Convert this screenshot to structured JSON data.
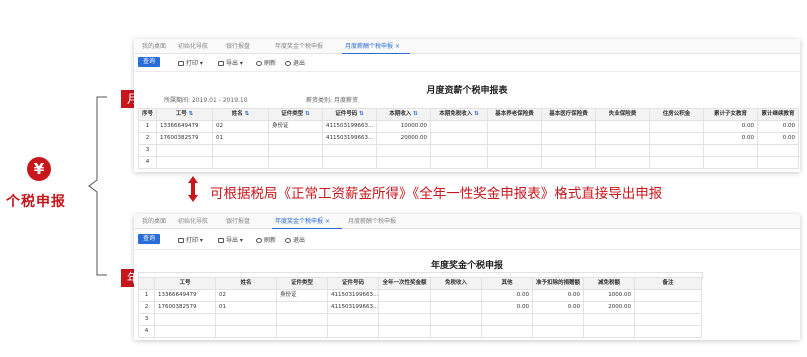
{
  "left": {
    "badge_icon": "¥",
    "title": "个税申报",
    "tag_month": "月度",
    "tag_year": "年度"
  },
  "arrow_text": "可根据税局《正常工资薪金所得》《全年一性奖金申报表》格式直接导出申报",
  "colors": {
    "accent": "#c8161d",
    "primary": "#2a6cd8"
  },
  "top_panel": {
    "tabs": [
      "我的桌面",
      "初始化导航",
      "银行报盘",
      "年度奖金个税申报",
      "月度薪酬个税申报"
    ],
    "active_tab": 4,
    "toolbar": {
      "query": "查询",
      "print": "打印",
      "export": "导出",
      "refresh": "刷新",
      "exit": "退出"
    },
    "report_title": "月度资薪个税申报表",
    "period_label": "所属期间:",
    "period_value": "2019.01 - 2019.10",
    "type_label": "薪资类别:",
    "type_value": "月度薪资",
    "columns": [
      "序号",
      "工号",
      "姓名",
      "证件类型",
      "证件号码",
      "本期收入",
      "本期免税收入",
      "基本养老保险费",
      "基本医疗保险费",
      "失业保险费",
      "住房公积金",
      "累计子女教育",
      "累计继续教育"
    ],
    "rows": [
      [
        "1",
        "13366649479",
        "02",
        "身份证",
        "411503199663...",
        "10000.00",
        "",
        "",
        "",
        "",
        "",
        "0.00",
        "0.00"
      ],
      [
        "2",
        "17600382579",
        "01",
        "",
        "411503199663...",
        "20000.00",
        "",
        "",
        "",
        "",
        "",
        "0.00",
        "0.00"
      ],
      [
        "3",
        "",
        "",
        "",
        "",
        "",
        "",
        "",
        "",
        "",
        "",
        "",
        ""
      ],
      [
        "4",
        "",
        "",
        "",
        "",
        "",
        "",
        "",
        "",
        "",
        "",
        "",
        ""
      ]
    ]
  },
  "bottom_panel": {
    "tabs": [
      "我的桌面",
      "初始化导航",
      "银行报盘",
      "年度奖金个税申报",
      "月度薪酬个税申报"
    ],
    "active_tab": 3,
    "toolbar": {
      "query": "查询",
      "print": "打印",
      "export": "导出",
      "refresh": "刷新",
      "exit": "退出"
    },
    "report_title": "年度奖金个税申报",
    "columns": [
      "",
      "工号",
      "姓名",
      "证件类型",
      "证件号码",
      "全年一次性奖金额",
      "免税收入",
      "其他",
      "准予扣除的捐赠额",
      "减免税额",
      "备注"
    ],
    "rows": [
      [
        "1",
        "13366649479",
        "02",
        "身份证",
        "411503199663...",
        "",
        "",
        "0.00",
        "0.00",
        "1000.00",
        ""
      ],
      [
        "2",
        "17600382579",
        "01",
        "",
        "411503199663...",
        "",
        "",
        "0.00",
        "0.00",
        "2000.00",
        ""
      ],
      [
        "3",
        "",
        "",
        "",
        "",
        "",
        "",
        "",
        "",
        "",
        ""
      ],
      [
        "4",
        "",
        "",
        "",
        "",
        "",
        "",
        "",
        "",
        "",
        ""
      ]
    ]
  }
}
